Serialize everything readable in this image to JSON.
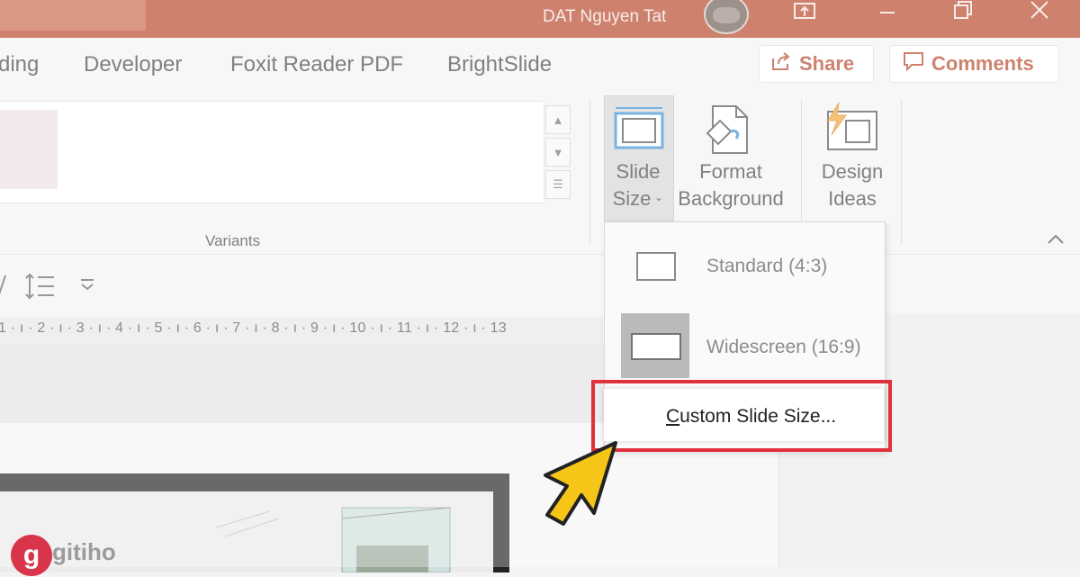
{
  "titlebar": {
    "user_name": "DAT Nguyen Tat",
    "bg": "#b7472a"
  },
  "tabs": [
    "ding",
    "Developer",
    "Foxit Reader PDF",
    "BrightSlide"
  ],
  "header_buttons": {
    "share": "Share",
    "comments": "Comments"
  },
  "ribbon": {
    "variants_label": "Variants",
    "slide_size": [
      "Slide",
      "Size"
    ],
    "format_background": [
      "Format",
      "Background"
    ],
    "design_ideas": [
      "Design",
      "Ideas"
    ]
  },
  "ruler": "1 · ı · 2 · ı · 3 · ı · 4 · ı · 5 · ı · 6 · ı · 7 · ı · 8 · ı · 9 · ı · 10 · ı · 11 · ı · 12 · ı · 13",
  "dropdown": {
    "standard": "Standard (4:3)",
    "widescreen": "Widescreen (16:9)",
    "custom_first": "C",
    "custom_rest": "ustom Slide Size..."
  },
  "highlight_color": "#e0303c",
  "cursor_color": "#f5c518",
  "logo": {
    "mark": "g",
    "text": "gitiho"
  },
  "icons": [
    "share-icon",
    "comment-icon",
    "slide-size-icon",
    "format-background-icon",
    "design-ideas-icon",
    "ribbon-collapse-icon",
    "line-spacing-icon",
    "pointer-cursor-icon"
  ]
}
